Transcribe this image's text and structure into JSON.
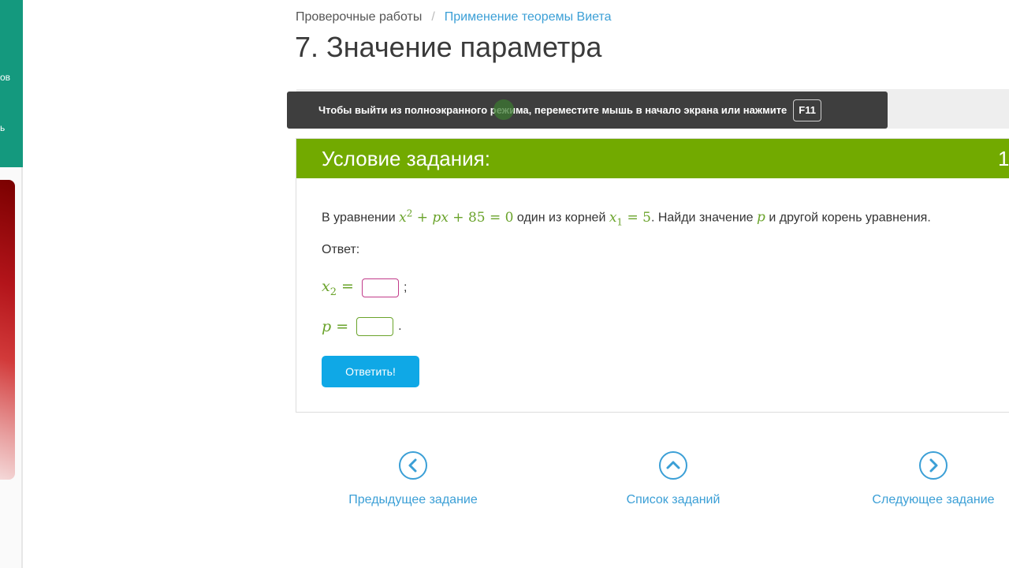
{
  "sidebar": {
    "label_1": "ов",
    "label_2": "ь"
  },
  "breadcrumb": {
    "parent": "Проверочные работы",
    "separator": "/",
    "current": "Применение теоремы Виета"
  },
  "page_title": "7. Значение параметра",
  "fullscreen_toast": {
    "message": "Чтобы выйти из полноэкранного режима, переместите мышь в начало экрана или нажмите",
    "key": "F11"
  },
  "task": {
    "header_title": "Условие задания:",
    "header_number": "1",
    "text_before": "В уравнении ",
    "equation": {
      "x": "x",
      "exp": "2",
      "rest_plus1": " + ",
      "p": "p",
      "x2": "x",
      "rest": " + 85 = 0"
    },
    "text_middle": " один из корней ",
    "root": {
      "x": "x",
      "sub": "1",
      "rest": " = 5"
    },
    "text_after_root": ". Найди значение ",
    "param": "p",
    "text_end": " и другой корень уравнения.",
    "answer_label": "Ответ:",
    "answer_x2": {
      "x": "x",
      "sub": "2",
      "eq": " =",
      "suffix": ";",
      "value": ""
    },
    "answer_p": {
      "p": "p",
      "eq": " =",
      "suffix": ".",
      "value": ""
    },
    "submit_label": "Ответить!"
  },
  "navigation": {
    "prev": {
      "label": "Предыдущее задание",
      "icon": "chevron-left-icon"
    },
    "list": {
      "label": "Список заданий",
      "icon": "chevron-up-icon"
    },
    "next": {
      "label": "Следующее задание",
      "icon": "chevron-right-icon"
    }
  },
  "colors": {
    "header_green": "#72aa00",
    "link_blue": "#3b9fd6",
    "button_blue": "#0fa8e6",
    "math_green": "#6aa32b",
    "sidebar_teal": "#14997e"
  }
}
